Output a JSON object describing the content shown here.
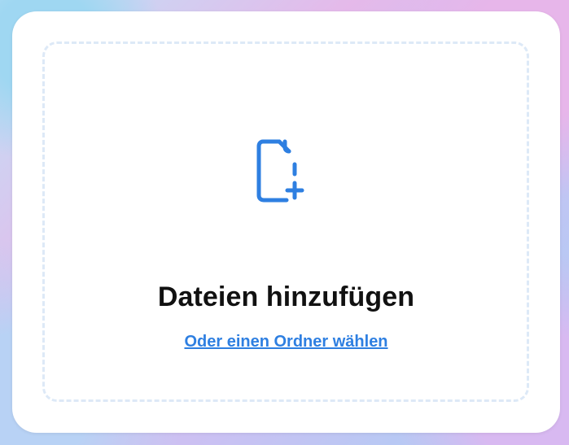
{
  "upload": {
    "icon": "file-plus-icon",
    "title": "Dateien hinzufügen",
    "folder_link": "Oder einen Ordner wählen"
  },
  "colors": {
    "accent": "#2e7fe1",
    "text": "#111111",
    "dashed_border": "#dde9f7"
  }
}
